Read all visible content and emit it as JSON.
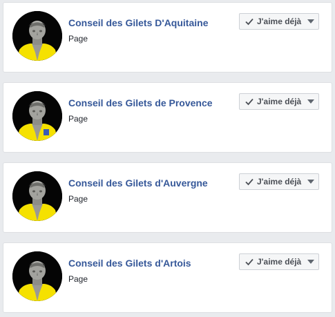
{
  "results": [
    {
      "name": "Conseil des Gilets D'Aquitaine",
      "type": "Page",
      "like_label": "J'aime déjà"
    },
    {
      "name": "Conseil des Gilets de Provence",
      "type": "Page",
      "like_label": "J'aime déjà"
    },
    {
      "name": "Conseil des Gilets d'Auvergne",
      "type": "Page",
      "like_label": "J'aime déjà"
    },
    {
      "name": "Conseil des Gilets d'Artois",
      "type": "Page",
      "like_label": "J'aime déjà"
    }
  ],
  "colors": {
    "background": "#e9ebee",
    "card": "#ffffff",
    "link": "#365899",
    "vest_yellow": "#f5e100"
  },
  "icons": {
    "like_check": "check-icon",
    "dropdown": "caret-down-icon"
  }
}
